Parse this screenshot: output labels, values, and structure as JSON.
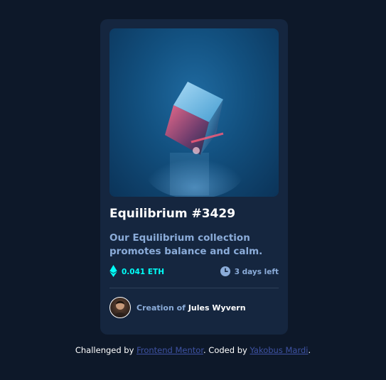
{
  "card": {
    "title": "Equilibrium #3429",
    "description": "Our Equilibrium collection promotes balance and calm.",
    "price": "0.041 ETH",
    "time_left": "3 days left",
    "creator_prefix": "Creation of",
    "creator_name": "Jules Wyvern"
  },
  "attribution": {
    "prefix": "Challenged by",
    "challenge_link": "Frontend Mentor",
    "middle": ". Coded by",
    "coder_link": "Yakobus Mardi",
    "suffix": "."
  },
  "colors": {
    "page_bg": "#0d1829",
    "card_bg": "#15263f",
    "accent_cyan": "#00fff8",
    "soft_blue": "#8bacd9",
    "link_blue": "#3e52a3"
  },
  "icons": {
    "price": "ethereum-icon",
    "time": "clock-icon"
  }
}
